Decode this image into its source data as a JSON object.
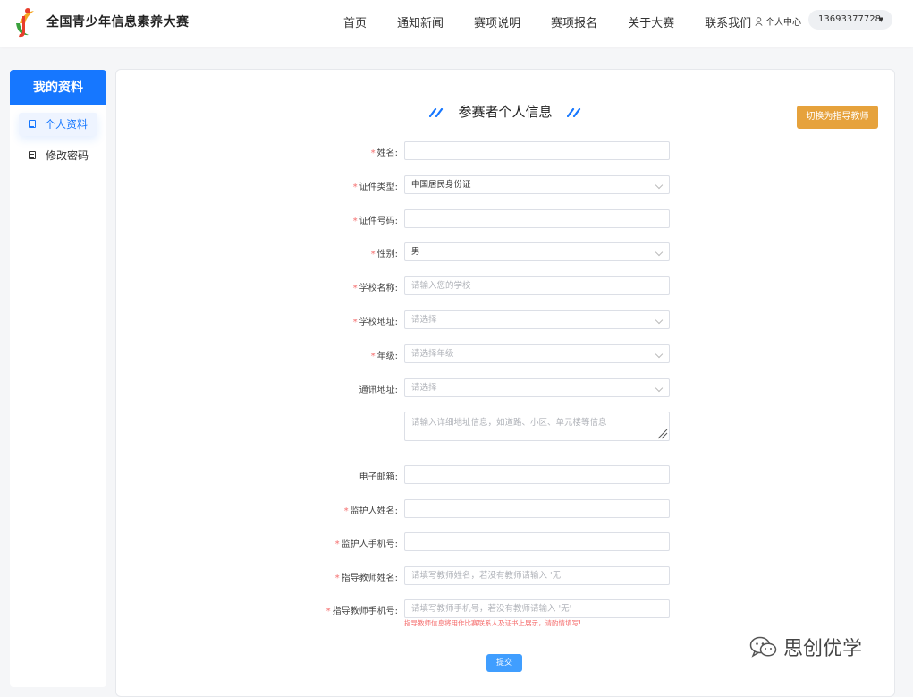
{
  "header": {
    "brand": "全国青少年信息素养大赛",
    "nav": [
      "首页",
      "通知新闻",
      "赛项说明",
      "赛项报名",
      "关于大赛",
      "联系我们"
    ],
    "user_center": "个人中心",
    "account": "13693377728",
    "logo_colors": [
      "#e83e2c",
      "#f5a623",
      "#3aa13d"
    ]
  },
  "sidebar": {
    "title": "我的资料",
    "items": [
      {
        "label": "个人资料",
        "active": true
      },
      {
        "label": "修改密码",
        "active": false
      }
    ]
  },
  "form": {
    "title": "参赛者个人信息",
    "switch_button": "切换为指导教师",
    "fields": [
      {
        "label": "姓名:",
        "required": true,
        "type": "input",
        "value": "",
        "placeholder": ""
      },
      {
        "label": "证件类型:",
        "required": true,
        "type": "select",
        "value": "中国居民身份证",
        "placeholder": ""
      },
      {
        "label": "证件号码:",
        "required": true,
        "type": "input",
        "value": "",
        "placeholder": ""
      },
      {
        "label": "性别:",
        "required": true,
        "type": "select",
        "value": "男",
        "placeholder": ""
      },
      {
        "label": "学校名称:",
        "required": true,
        "type": "input",
        "value": "",
        "placeholder": "请输入您的学校"
      },
      {
        "label": "学校地址:",
        "required": true,
        "type": "select",
        "value": "",
        "placeholder": "请选择"
      },
      {
        "label": "年级:",
        "required": true,
        "type": "select",
        "value": "",
        "placeholder": "请选择年级"
      },
      {
        "label": "通讯地址:",
        "required": false,
        "type": "select",
        "value": "",
        "placeholder": "请选择"
      },
      {
        "label": "",
        "required": false,
        "type": "textarea",
        "value": "",
        "placeholder": "请输入详细地址信息，如道路、小区、单元楼等信息"
      },
      {
        "label": "电子邮箱:",
        "required": false,
        "type": "input",
        "value": "",
        "placeholder": ""
      },
      {
        "label": "监护人姓名:",
        "required": true,
        "type": "input",
        "value": "",
        "placeholder": ""
      },
      {
        "label": "监护人手机号:",
        "required": true,
        "type": "input",
        "value": "",
        "placeholder": ""
      },
      {
        "label": "指导教师姓名:",
        "required": true,
        "type": "input",
        "value": "",
        "placeholder": "请填写教师姓名，若没有教师请输入 '无'"
      },
      {
        "label": "指导教师手机号:",
        "required": true,
        "type": "input",
        "value": "",
        "placeholder": "请填写教师手机号，若没有教师请输入 '无'"
      }
    ],
    "hint": "指导教师信息将用作比赛联系人及证书上展示，请酌情填写!",
    "submit": "提交"
  },
  "watermark": "思创优学",
  "colors": {
    "primary": "#1677ff",
    "warning": "#e6a23c",
    "submit": "#409eff",
    "required": "#f56c6c"
  }
}
